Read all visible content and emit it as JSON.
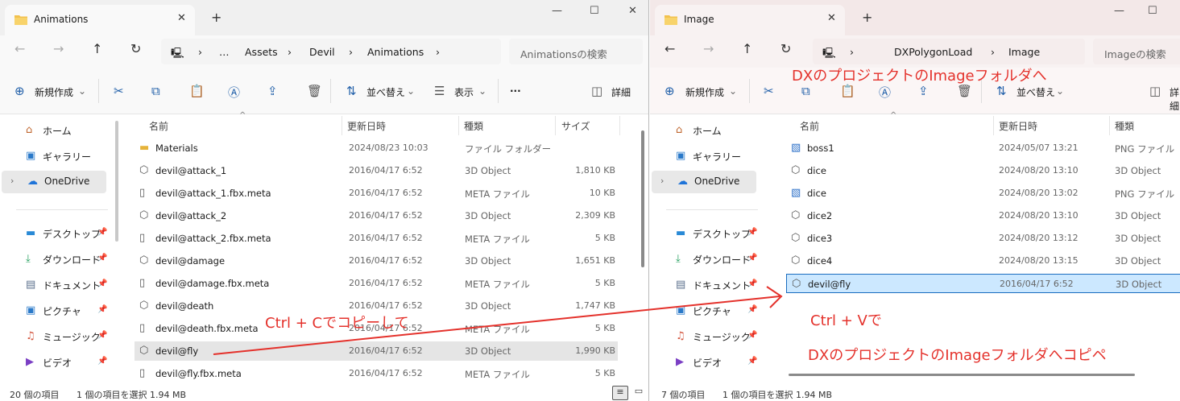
{
  "left_window": {
    "tab_title": "Animations",
    "breadcrumb": [
      "…",
      "Assets",
      "Devil",
      "Animations"
    ],
    "search_placeholder": "Animationsの検索",
    "toolbar": {
      "new": "新規作成",
      "sort": "並べ替え",
      "view": "表示",
      "details": "詳細"
    },
    "sidebar": {
      "home": "ホーム",
      "gallery": "ギャラリー",
      "onedrive": "OneDrive",
      "quick": [
        "デスクトップ",
        "ダウンロード",
        "ドキュメント",
        "ピクチャ",
        "ミュージック",
        "ビデオ"
      ]
    },
    "columns": {
      "name": "名前",
      "date": "更新日時",
      "type": "種類",
      "size": "サイズ"
    },
    "files": [
      {
        "name": "Materials",
        "date": "2024/08/23 10:03",
        "type": "ファイル フォルダー",
        "size": "",
        "icon": "folder-icon"
      },
      {
        "name": "devil@attack_1",
        "date": "2016/04/17 6:52",
        "type": "3D Object",
        "size": "1,810 KB",
        "icon": "3d-object-icon"
      },
      {
        "name": "devil@attack_1.fbx.meta",
        "date": "2016/04/17 6:52",
        "type": "META ファイル",
        "size": "10 KB",
        "icon": "file-icon"
      },
      {
        "name": "devil@attack_2",
        "date": "2016/04/17 6:52",
        "type": "3D Object",
        "size": "2,309 KB",
        "icon": "3d-object-icon"
      },
      {
        "name": "devil@attack_2.fbx.meta",
        "date": "2016/04/17 6:52",
        "type": "META ファイル",
        "size": "5 KB",
        "icon": "file-icon"
      },
      {
        "name": "devil@damage",
        "date": "2016/04/17 6:52",
        "type": "3D Object",
        "size": "1,651 KB",
        "icon": "3d-object-icon"
      },
      {
        "name": "devil@damage.fbx.meta",
        "date": "2016/04/17 6:52",
        "type": "META ファイル",
        "size": "5 KB",
        "icon": "file-icon"
      },
      {
        "name": "devil@death",
        "date": "2016/04/17 6:52",
        "type": "3D Object",
        "size": "1,747 KB",
        "icon": "3d-object-icon"
      },
      {
        "name": "devil@death.fbx.meta",
        "date": "2016/04/17 6:52",
        "type": "META ファイル",
        "size": "5 KB",
        "icon": "file-icon"
      },
      {
        "name": "devil@fly",
        "date": "2016/04/17 6:52",
        "type": "3D Object",
        "size": "1,990 KB",
        "icon": "3d-object-icon"
      },
      {
        "name": "devil@fly.fbx.meta",
        "date": "2016/04/17 6:52",
        "type": "META ファイル",
        "size": "5 KB",
        "icon": "file-icon"
      }
    ],
    "status": {
      "count": "20 個の項目",
      "selected": "1 個の項目を選択 1.94 MB"
    }
  },
  "right_window": {
    "tab_title": "Image",
    "breadcrumb": [
      "DXPolygonLoad",
      "Image"
    ],
    "search_placeholder": "Imageの検索",
    "toolbar": {
      "new": "新規作成",
      "sort": "並べ替え",
      "details": "詳細"
    },
    "sidebar": {
      "home": "ホーム",
      "gallery": "ギャラリー",
      "onedrive": "OneDrive",
      "quick": [
        "デスクトップ",
        "ダウンロード",
        "ドキュメント",
        "ピクチャ",
        "ミュージック",
        "ビデオ"
      ]
    },
    "columns": {
      "name": "名前",
      "date": "更新日時",
      "type": "種類"
    },
    "files": [
      {
        "name": "boss1",
        "date": "2024/05/07 13:21",
        "type": "PNG ファイル",
        "icon": "png-icon"
      },
      {
        "name": "dice",
        "date": "2024/08/20 13:10",
        "type": "3D Object",
        "icon": "3d-object-icon"
      },
      {
        "name": "dice",
        "date": "2024/08/20 13:02",
        "type": "PNG ファイル",
        "icon": "png-icon"
      },
      {
        "name": "dice2",
        "date": "2024/08/20 13:10",
        "type": "3D Object",
        "icon": "3d-object-icon"
      },
      {
        "name": "dice3",
        "date": "2024/08/20 13:12",
        "type": "3D Object",
        "icon": "3d-object-icon"
      },
      {
        "name": "dice4",
        "date": "2024/08/20 13:15",
        "type": "3D Object",
        "icon": "3d-object-icon"
      },
      {
        "name": "devil@fly",
        "date": "2016/04/17 6:52",
        "type": "3D Object",
        "icon": "3d-object-icon"
      }
    ],
    "status": {
      "count": "7 個の項目",
      "selected": "1 個の項目を選択 1.94 MB"
    }
  },
  "annotations": {
    "top": "DXのプロジェクトのImageフォルダへ",
    "copy": "Ctrl + Cでコピーして",
    "paste": "Ctrl + Vで",
    "paste2": "DXのプロジェクトのImageフォルダへコピペ",
    "color": "#e4312b"
  }
}
